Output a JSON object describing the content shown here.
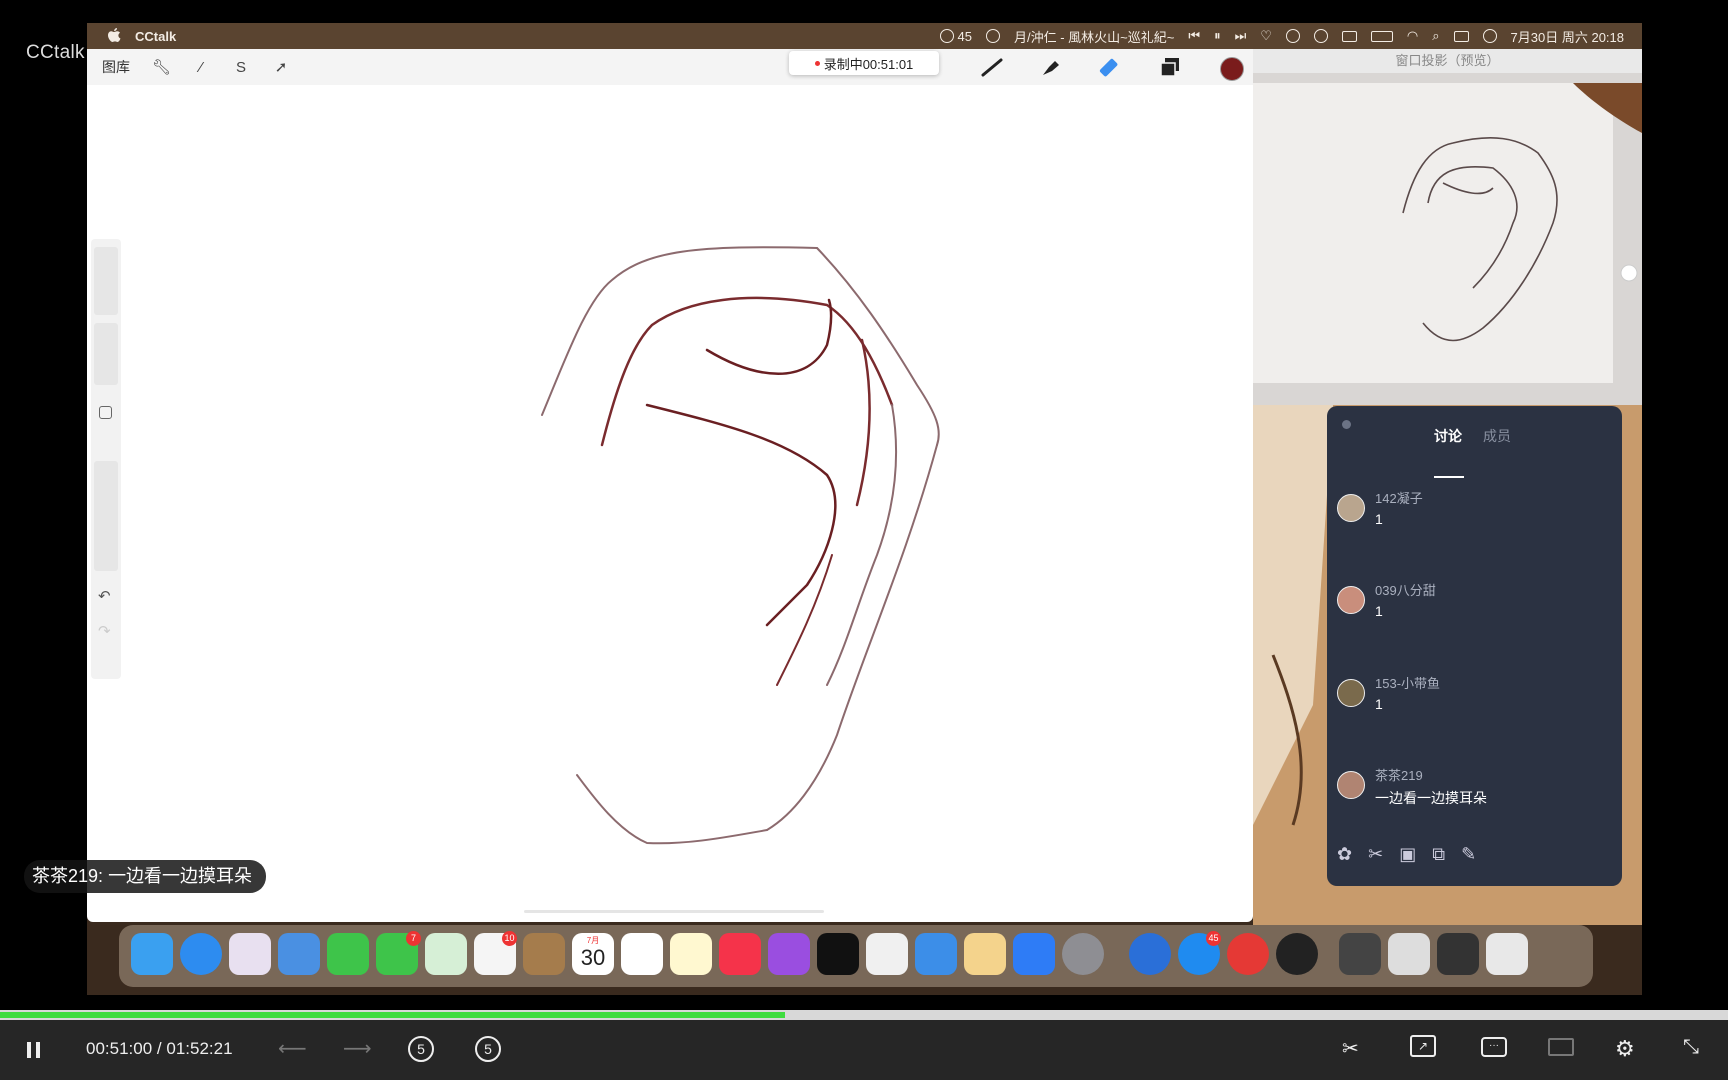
{
  "player": {
    "logo": "CCtalk",
    "current_time": "00:51:00",
    "separator": "/",
    "duration": "01:52:21",
    "progress_fraction": 0.454,
    "colors": {
      "progress": "#3fdc3f",
      "bar_bg": "#262626"
    },
    "controls": {
      "pause_icon": "pause-icon",
      "prev_icon": "arrow-left-icon",
      "next_icon": "arrow-right-icon",
      "rewind_label": "5",
      "forward_label": "5",
      "right_icons": [
        "scissors-icon",
        "share-icon",
        "comment-icon",
        "picture-in-picture-icon",
        "gear-icon",
        "exit-fullscreen-icon"
      ]
    }
  },
  "menubar": {
    "app_name": "CCtalk",
    "status_count": "45",
    "now_playing": "月/沖仁 - 風林火山~巡礼紀~",
    "datetime": "7月30日 周六 20:18"
  },
  "procreate": {
    "gallery_label": "图库",
    "recording_label": "录制中00:51:01",
    "brush_color": "#7a1c1c"
  },
  "preview": {
    "title": "窗口投影（预览）"
  },
  "chat": {
    "tabs": [
      "讨论",
      "成员"
    ],
    "messages": [
      {
        "user": "142凝子",
        "text": "1"
      },
      {
        "user": "039八分甜",
        "text": "1"
      },
      {
        "user": "153-小带鱼",
        "text": "1"
      },
      {
        "user": "茶茶219",
        "text": "一边看一边摸耳朵"
      }
    ]
  },
  "dock": {
    "calendar_month": "7月",
    "calendar_day": "30",
    "messages_badge": "7",
    "photos_badge": "10",
    "app_badge": "45"
  },
  "danmaku": {
    "user": "茶茶219:",
    "text": "一边看一边摸耳朵"
  }
}
